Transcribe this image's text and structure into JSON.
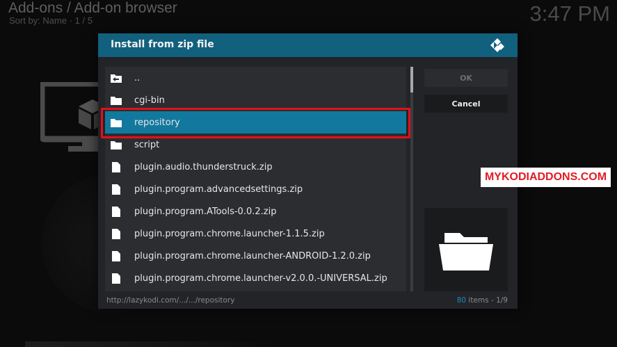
{
  "background": {
    "title": "Add-ons / Add-on browser",
    "subtitle": "Sort by: Name  ·  1 / 5",
    "clock": "3:47 PM"
  },
  "dialog": {
    "title": "Install from zip file",
    "items": [
      {
        "label": "..",
        "icon": "back-folder-icon"
      },
      {
        "label": "cgi-bin",
        "icon": "folder-icon"
      },
      {
        "label": "repository",
        "icon": "folder-icon",
        "selected": true
      },
      {
        "label": "script",
        "icon": "folder-icon"
      },
      {
        "label": "plugin.audio.thunderstruck.zip",
        "icon": "file-icon"
      },
      {
        "label": "plugin.program.advancedsettings.zip",
        "icon": "file-icon"
      },
      {
        "label": "plugin.program.ATools-0.0.2.zip",
        "icon": "file-icon"
      },
      {
        "label": "plugin.program.chrome.launcher-1.1.5.zip",
        "icon": "file-icon"
      },
      {
        "label": "plugin.program.chrome.launcher-ANDROID-1.2.0.zip",
        "icon": "file-icon"
      },
      {
        "label": "plugin.program.chrome.launcher-v2.0.0.-UNIVERSAL.zip",
        "icon": "file-icon"
      }
    ],
    "ok_label": "OK",
    "cancel_label": "Cancel",
    "path": "http://lazykodi.com/.../.../repository",
    "count_num": "80",
    "count_rest": " items - 1/9"
  },
  "watermark": "MYKODIADDONS.COM",
  "colors": {
    "header": "#11607e",
    "selected": "#12789e",
    "highlight": "#e3101b",
    "watermark_text": "#e31b23"
  }
}
